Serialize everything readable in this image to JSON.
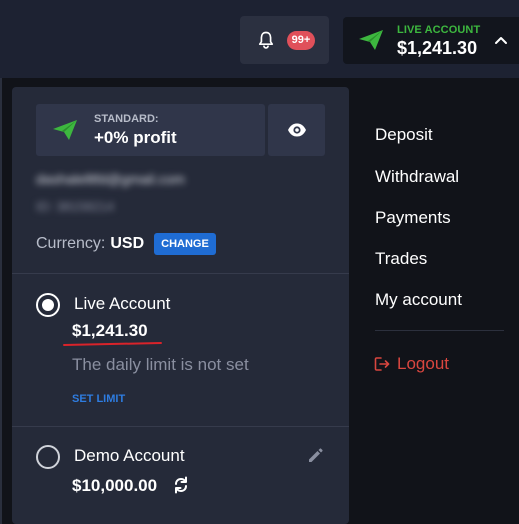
{
  "topbar": {
    "notifications_badge": "99+",
    "account": {
      "type_label": "LIVE ACCOUNT",
      "balance": "$1,241.30"
    }
  },
  "profile": {
    "plan_label": "STANDARD:",
    "plan_value": "+0% profit",
    "email": "dashalelltfd@gmail.com",
    "user_id": "ID: 38158214",
    "currency_label": "Currency:",
    "currency_value": "USD",
    "change_label": "CHANGE"
  },
  "accounts": {
    "live": {
      "name": "Live Account",
      "balance": "$1,241.30",
      "limit_text": "The daily limit is not set",
      "set_limit_label": "SET LIMIT"
    },
    "demo": {
      "name": "Demo Account",
      "balance": "$10,000.00"
    }
  },
  "menu": {
    "items": [
      "Deposit",
      "Withdrawal",
      "Payments",
      "Trades",
      "My account"
    ],
    "logout_label": "Logout"
  },
  "colors": {
    "background": "#1d2232",
    "panel": "#252a39",
    "accent_green": "#3db73f",
    "accent_blue": "#1f6cd3",
    "badge_red": "#e0505a",
    "logout_red": "#d9463f",
    "underline_red": "#d9232a"
  },
  "icons": {
    "bell": "bell-icon",
    "plane": "paper-plane-icon",
    "chevron": "chevron-up-icon",
    "eye": "eye-icon",
    "refresh": "refresh-icon",
    "edit": "pencil-icon",
    "logout": "logout-icon"
  }
}
